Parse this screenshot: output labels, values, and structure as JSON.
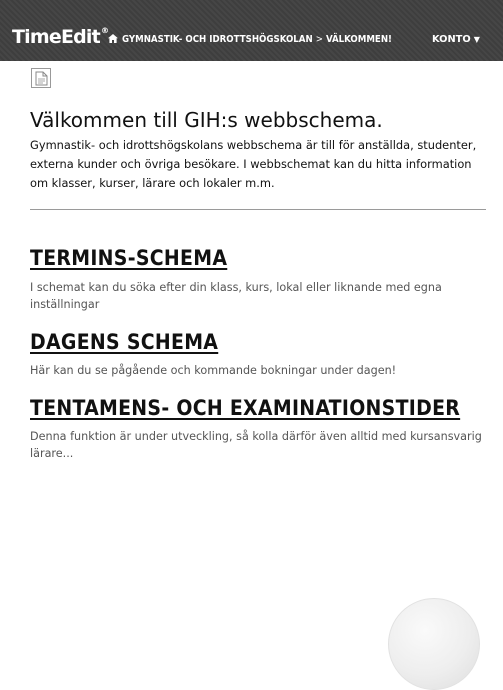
{
  "header": {
    "logo_text": "TimeEdit",
    "logo_mark": "®",
    "home_icon": "home-icon",
    "breadcrumb": {
      "institution": "GYMNASTIK- OCH IDROTTSHÖGSKOLAN",
      "separator": ">",
      "page": "VÄLKOMMEN!"
    },
    "account_menu": {
      "label": "KONTO",
      "caret": "▼"
    }
  },
  "main": {
    "document_icon": "document-icon",
    "welcome": {
      "title": "Välkommen till GIH:s webbschema.",
      "text": "Gymnastik- och idrottshögskolans webbschema är till för anställda, studenter, externa kunder och övriga besökare. I webbschemat kan du hitta information om klasser, kurser, lärare och lokaler m.m."
    },
    "sections": [
      {
        "title": "TERMINS-SCHEMA",
        "description": "I schemat kan du söka efter din klass, kurs, lokal eller liknande med egna inställningar"
      },
      {
        "title": "DAGENS SCHEMA",
        "description": "Här kan du se pågående och kommande bokningar under dagen!"
      },
      {
        "title": "TENTAMENS- OCH EXAMINATIONSTIDER",
        "description": "Denna funktion är under utveckling, så kolla därför även alltid med kursansvarig lärare..."
      }
    ]
  },
  "colors": {
    "header_bg": "#404040",
    "header_text": "#ffffff",
    "title_text": "#111111",
    "desc_text": "#555555",
    "divider": "#9a9a9a"
  }
}
